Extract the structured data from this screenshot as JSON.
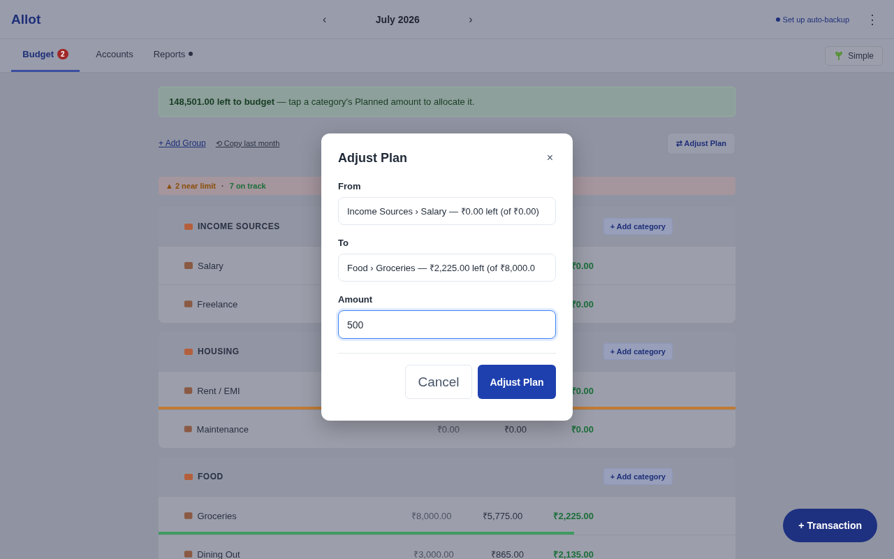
{
  "header": {
    "logo": "Allot",
    "prev": "‹",
    "month": "July 2026",
    "next": "›",
    "backup": "Set up auto-backup",
    "menu": "⋮"
  },
  "tabs": [
    {
      "label": "Budget",
      "badge": "2",
      "dot": false,
      "selected": true
    },
    {
      "label": "Accounts",
      "dot": false,
      "selected": false
    },
    {
      "label": "Reports",
      "dot": true,
      "selected": false
    }
  ],
  "mode_button": {
    "label": "Simple"
  },
  "banner": "**148,501.00 left to budget** — tap a category's Planned amount to allocate it.",
  "actions": {
    "add_group": "+ Add Group",
    "copy": "⟲ Copy last month",
    "adjust": "⇄ Adjust Plan"
  },
  "status": {
    "items": [
      {
        "text": "▲ 2 near limit",
        "color": "#8a4f0a"
      },
      {
        "text": "7 on track",
        "color": "#1c6e3a"
      }
    ],
    "separator": "·"
  },
  "groups": [
    {
      "name": "INCOME SOURCES",
      "add": "+ Add category",
      "categories": [
        {
          "name": "Salary",
          "remaining": "₹0.00"
        },
        {
          "name": "Freelance",
          "remaining": "₹0.00"
        }
      ]
    },
    {
      "name": "HOUSING",
      "add": "+ Add category",
      "categories": [
        {
          "name": "Rent / EMI",
          "remaining": "₹0.00",
          "bar": {
            "level": 1,
            "color": "#c07a35"
          }
        },
        {
          "name": "Maintenance",
          "planned": "₹0.00",
          "spent": "₹0.00",
          "remaining": "₹0.00"
        }
      ]
    },
    {
      "name": "FOOD",
      "add": "+ Add category",
      "categories": [
        {
          "name": "Groceries",
          "planned": "₹8,000.00",
          "spent": "₹5,775.00",
          "remaining": "₹2,225.00",
          "bar": {
            "level": 0.72,
            "color": "#3f9a60"
          }
        },
        {
          "name": "Dining Out",
          "planned": "₹3,000.00",
          "spent": "₹865.00",
          "remaining": "₹2,135.00"
        }
      ]
    }
  ],
  "fab": "+ Transaction",
  "modal": {
    "title": "Adjust Plan",
    "close": "×",
    "fields": [
      {
        "label": "From",
        "kind": "select",
        "value": "Income Sources › Salary — ₹0.00 left (of ₹0.00)",
        "focused": false
      },
      {
        "label": "To",
        "kind": "select",
        "value": "Food › Groceries — ₹2,225.00 left (of ₹8,000.0",
        "focused": false
      },
      {
        "label": "Amount",
        "kind": "number",
        "value": "500",
        "focused": true
      }
    ],
    "buttons": [
      {
        "label": "Cancel",
        "kind": "secondary"
      },
      {
        "label": "Adjust Plan",
        "kind": "primary"
      }
    ]
  }
}
